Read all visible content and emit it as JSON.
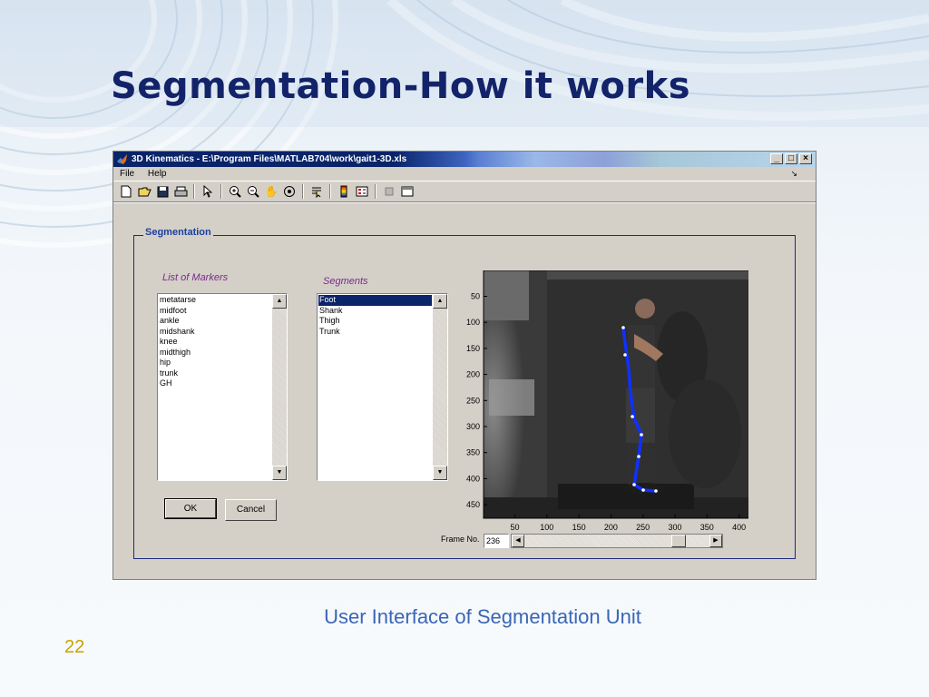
{
  "slide": {
    "title": "Segmentation-How it works",
    "caption": "User Interface of Segmentation Unit",
    "page_number": "22"
  },
  "window": {
    "title": "3D Kinematics - E:\\Program Files\\MATLAB704\\work\\gait1-3D.xls",
    "controls": [
      "minimize",
      "maximize",
      "close"
    ],
    "menu": [
      "File",
      "Help"
    ],
    "toolbar_icons": [
      "new-file-icon",
      "open-folder-icon",
      "save-icon",
      "print-icon",
      "pointer-icon",
      "zoom-in-icon",
      "zoom-out-icon",
      "pan-hand-icon",
      "rotate-3d-icon",
      "data-cursor-icon",
      "colorbar-icon",
      "legend-icon",
      "hide-plot-tools-icon",
      "show-plot-tools-icon"
    ]
  },
  "segmentation": {
    "group_label": "Segmentation",
    "markers_caption": "List of Markers",
    "markers": [
      "metatarse",
      "midfoot",
      "ankle",
      "midshank",
      "knee",
      "midthigh",
      "hip",
      "trunk",
      "GH"
    ],
    "segments_caption": "Segments",
    "segments": [
      "Foot",
      "Shank",
      "Thigh",
      "Trunk"
    ],
    "selected_segment": "Foot",
    "ok_label": "OK",
    "cancel_label": "Cancel"
  },
  "viewer": {
    "y_ticks": [
      "50",
      "100",
      "150",
      "200",
      "250",
      "300",
      "350",
      "400",
      "450"
    ],
    "x_ticks": [
      "50",
      "100",
      "150",
      "200",
      "250",
      "300",
      "350",
      "400"
    ],
    "frame_label": "Frame No.",
    "frame_value": "236",
    "slider_position": 0.86
  },
  "colors": {
    "title": "#13236a",
    "caption": "#3a66b6",
    "page_number": "#c7a200",
    "segment_line": "#1030ff",
    "selection": "#0a246a"
  }
}
